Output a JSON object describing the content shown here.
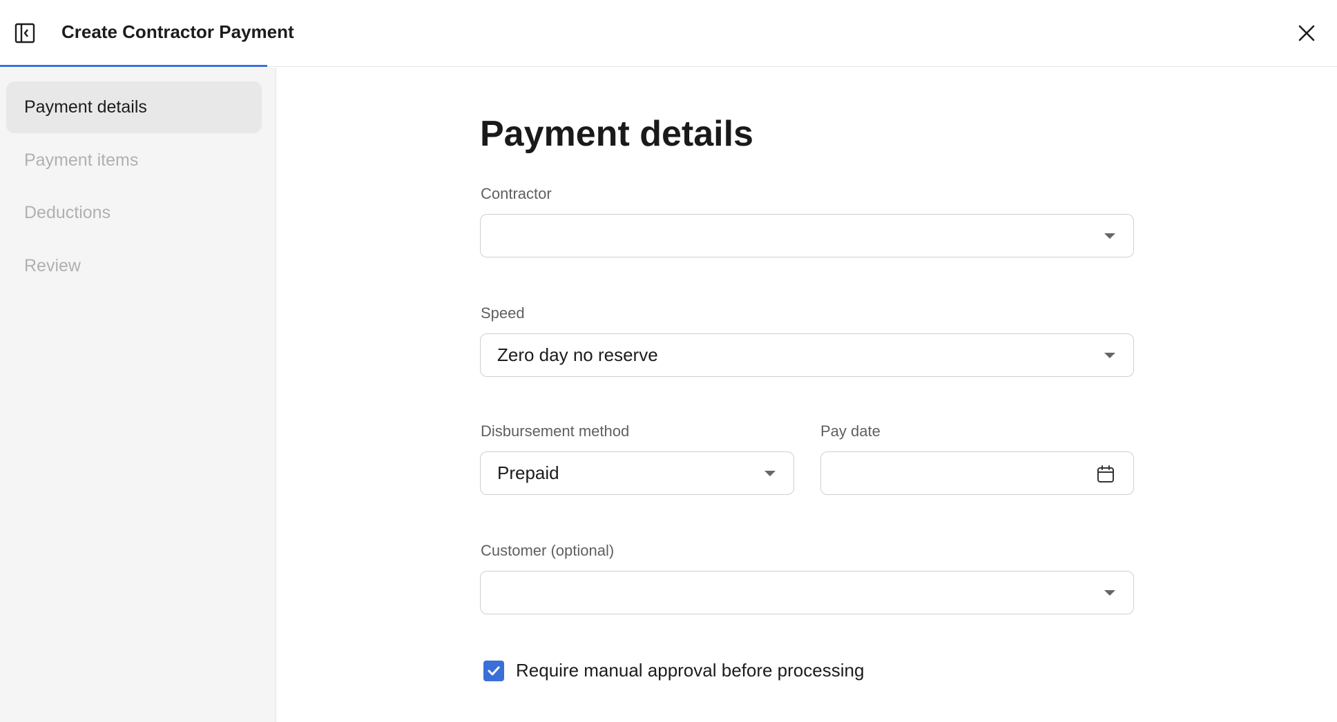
{
  "header": {
    "title": "Create Contractor Payment",
    "progress_fraction": 0.2
  },
  "sidebar": {
    "items": [
      {
        "label": "Payment details",
        "active": true
      },
      {
        "label": "Payment items",
        "active": false
      },
      {
        "label": "Deductions",
        "active": false
      },
      {
        "label": "Review",
        "active": false
      }
    ]
  },
  "form": {
    "title": "Payment details",
    "contractor": {
      "label": "Contractor",
      "value": ""
    },
    "speed": {
      "label": "Speed",
      "value": "Zero day no reserve"
    },
    "disbursement": {
      "label": "Disbursement method",
      "value": "Prepaid"
    },
    "pay_date": {
      "label": "Pay date",
      "value": ""
    },
    "customer": {
      "label": "Customer (optional)",
      "value": ""
    },
    "manual_approval": {
      "label": "Require manual approval before processing",
      "checked": true
    }
  },
  "colors": {
    "accent": "#3b6fd8",
    "sidebar_bg": "#f5f5f5",
    "active_item_bg": "#e8e8e8",
    "muted_text": "#b0b0b0"
  },
  "icons": {
    "panel_toggle": "sidebar-collapse-icon",
    "close": "close-icon",
    "calendar": "calendar-icon",
    "dropdown": "chevron-down-icon",
    "check": "checkmark-icon"
  }
}
